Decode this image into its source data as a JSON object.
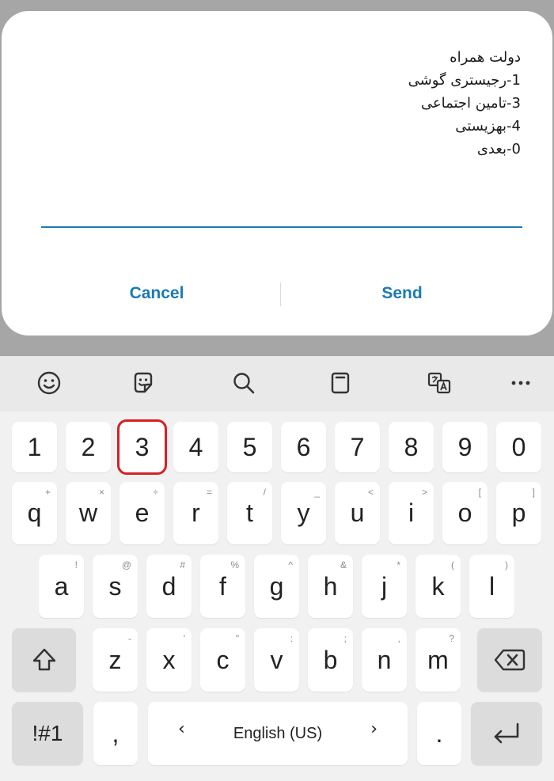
{
  "dialog": {
    "message_lines": [
      "دولت همراه",
      "1-رجیستری گوشی",
      "3-تامین اجتماعی",
      "4-بهزیستی",
      "0-بعدی"
    ],
    "reply_value": "",
    "cancel_label": "Cancel",
    "send_label": "Send"
  },
  "toolbar": {
    "icons": [
      "emoji-icon",
      "sticker-icon",
      "search-icon",
      "clipboard-icon",
      "translate-icon",
      "more-icon"
    ]
  },
  "keyboard": {
    "number_row": [
      "1",
      "2",
      "3",
      "4",
      "5",
      "6",
      "7",
      "8",
      "9",
      "0"
    ],
    "row1": [
      {
        "key": "q",
        "sub": "+"
      },
      {
        "key": "w",
        "sub": "×"
      },
      {
        "key": "e",
        "sub": "÷"
      },
      {
        "key": "r",
        "sub": "="
      },
      {
        "key": "t",
        "sub": "/"
      },
      {
        "key": "y",
        "sub": "_"
      },
      {
        "key": "u",
        "sub": "<"
      },
      {
        "key": "i",
        "sub": ">"
      },
      {
        "key": "o",
        "sub": "["
      },
      {
        "key": "p",
        "sub": "]"
      }
    ],
    "row2": [
      {
        "key": "a",
        "sub": "!"
      },
      {
        "key": "s",
        "sub": "@"
      },
      {
        "key": "d",
        "sub": "#"
      },
      {
        "key": "f",
        "sub": "%"
      },
      {
        "key": "g",
        "sub": "^"
      },
      {
        "key": "h",
        "sub": "&"
      },
      {
        "key": "j",
        "sub": "*"
      },
      {
        "key": "k",
        "sub": "("
      },
      {
        "key": "l",
        "sub": ")"
      }
    ],
    "row3": [
      {
        "key": "z",
        "sub": "-"
      },
      {
        "key": "x",
        "sub": "'"
      },
      {
        "key": "c",
        "sub": "\""
      },
      {
        "key": "v",
        "sub": ":"
      },
      {
        "key": "b",
        "sub": ";"
      },
      {
        "key": "n",
        "sub": ","
      },
      {
        "key": "m",
        "sub": "?"
      }
    ],
    "symbols_label": "!#1",
    "comma_label": ",",
    "period_label": ".",
    "space_label": "English (US)",
    "space_left_arrow": "‹",
    "space_right_arrow": "›",
    "highlighted_key": "3",
    "highlight_color": "#d71f26"
  },
  "colors": {
    "accent": "#1c7bb2",
    "keyboard_bg": "#f1f1f1",
    "dim_overlay": "#a6a6a6"
  }
}
